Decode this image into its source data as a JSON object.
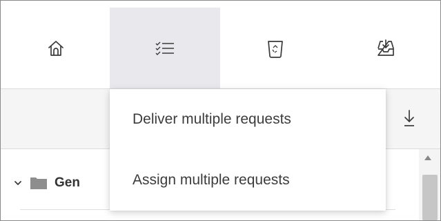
{
  "toolbar": {
    "icons": [
      "home-icon",
      "checklist-icon",
      "recycle-bin-icon",
      "inbox-download-icon"
    ],
    "active_index": 1
  },
  "menu": {
    "items": [
      {
        "label": "Deliver multiple requests"
      },
      {
        "label": "Assign multiple requests"
      }
    ]
  },
  "tree": {
    "folder_label": "Gen"
  },
  "icons": {
    "download": "download-icon",
    "chevron": "chevron-down-icon",
    "folder": "folder-icon"
  },
  "colors": {
    "active_tab_bg": "#e8e8ed",
    "subbar_bg": "#f5f5f5"
  }
}
